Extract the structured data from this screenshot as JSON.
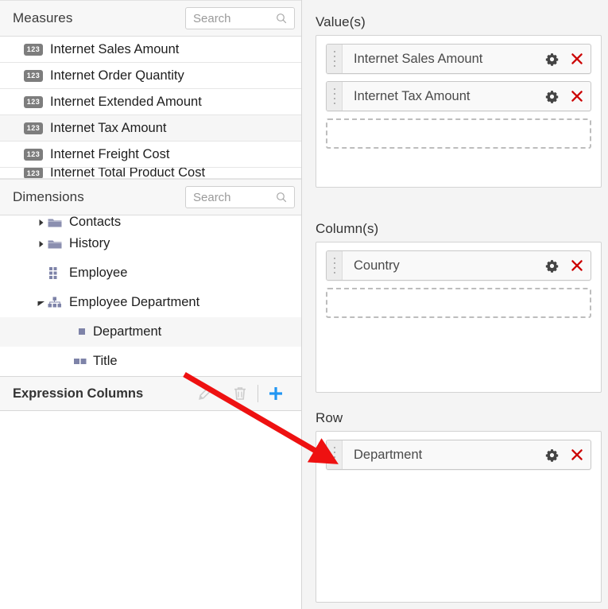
{
  "measures_panel": {
    "title": "Measures",
    "search": {
      "placeholder": "Search",
      "value": "",
      "icon": "search-icon"
    },
    "items": [
      {
        "label": "Internet Sales Amount",
        "icon": "number-123-icon",
        "selected": false
      },
      {
        "label": "Internet Order Quantity",
        "icon": "number-123-icon",
        "selected": false
      },
      {
        "label": "Internet Extended Amount",
        "icon": "number-123-icon",
        "selected": false
      },
      {
        "label": "Internet Tax Amount",
        "icon": "number-123-icon",
        "selected": true
      },
      {
        "label": "Internet Freight Cost",
        "icon": "number-123-icon",
        "selected": false
      },
      {
        "label": "Internet Total Product Cost",
        "icon": "number-123-icon",
        "selected": false
      }
    ]
  },
  "dimensions_panel": {
    "title": "Dimensions",
    "search": {
      "placeholder": "Search",
      "value": "",
      "icon": "search-icon"
    },
    "items": [
      {
        "label": "Contacts",
        "icon": "folder-icon",
        "caret": "collapsed",
        "indent": 0,
        "highlighted": false
      },
      {
        "label": "History",
        "icon": "folder-icon",
        "caret": "collapsed",
        "indent": 0,
        "highlighted": false
      },
      {
        "label": "Employee",
        "icon": "dimension-grid-icon",
        "caret": "none",
        "indent": 1,
        "highlighted": false
      },
      {
        "label": "Employee Department",
        "icon": "hierarchy-icon",
        "caret": "expanded",
        "indent": 0,
        "highlighted": false
      },
      {
        "label": "Department",
        "icon": "attribute-square-icon",
        "caret": "none",
        "indent": 3,
        "highlighted": true
      },
      {
        "label": "Title",
        "icon": "attribute-double-square-icon",
        "caret": "none",
        "indent": 3,
        "highlighted": false
      }
    ]
  },
  "expression_columns": {
    "title": "Expression Columns",
    "actions": [
      {
        "name": "edit-expression-button",
        "icon": "pencil-icon",
        "enabled": false
      },
      {
        "name": "delete-expression-button",
        "icon": "trash-icon",
        "enabled": false
      },
      {
        "name": "add-expression-button",
        "icon": "plus-icon",
        "enabled": true
      }
    ],
    "accent_color": "#2196f3"
  },
  "axes": {
    "values": {
      "title": "Value(s)",
      "fields": [
        {
          "label": "Internet Sales Amount",
          "gear_icon": "gear-icon",
          "remove_icon": "close-x-icon"
        },
        {
          "label": "Internet Tax Amount",
          "gear_icon": "gear-icon",
          "remove_icon": "close-x-icon"
        }
      ],
      "dropzone_label": ""
    },
    "columns": {
      "title": "Column(s)",
      "fields": [
        {
          "label": "Country",
          "gear_icon": "gear-icon",
          "remove_icon": "close-x-icon"
        }
      ],
      "dropzone_label": ""
    },
    "rows": {
      "title": "Row",
      "fields": [
        {
          "label": "Department",
          "gear_icon": "gear-icon",
          "remove_icon": "close-x-icon"
        }
      ],
      "dropzone_label": ""
    }
  },
  "annotation": {
    "arrow_color": "#ee1111",
    "from_label": "Department",
    "to_label": "Department"
  }
}
